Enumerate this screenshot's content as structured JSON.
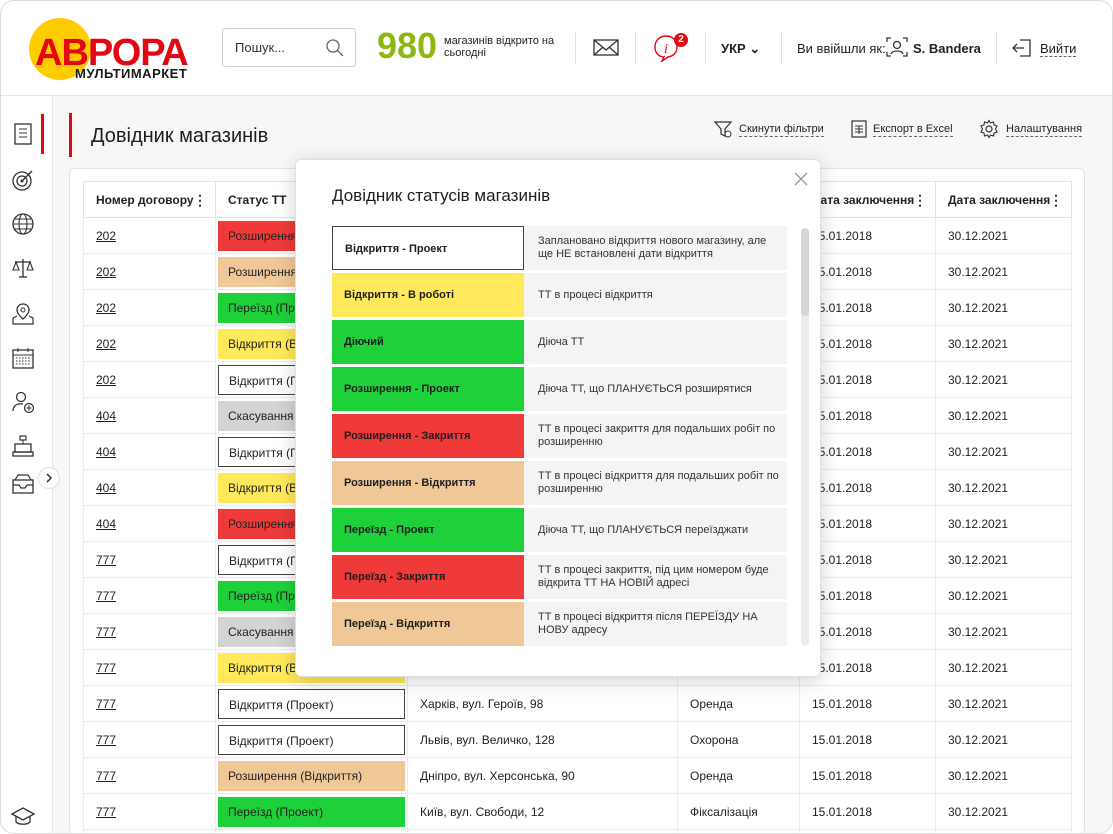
{
  "brand": {
    "logo_text": "АВРОРА",
    "logo_sub": "МУЛЬТИМАРКЕТ"
  },
  "header": {
    "search_placeholder": "Пошук...",
    "stores_open_count": "980",
    "stores_open_label": "магазинів відкрито на сьогодні",
    "notifications_count": "2",
    "language": "УКР",
    "logged_in_as": "Ви ввійшли як:",
    "user_name": "S. Bandera",
    "logout": "Вийти"
  },
  "page": {
    "title": "Довідник магазинів",
    "reset_filters": "Скинути фільтри",
    "export_excel": "Експорт в Excel",
    "settings": "Налаштування"
  },
  "table": {
    "columns": [
      "Номер договору",
      "Статус ТТ",
      "",
      "",
      "Дата заключення",
      "Дата заключення"
    ],
    "rows": [
      {
        "contract": "202",
        "status": "Розширення (Закриття)",
        "status_color": "#f03a3a",
        "address": "",
        "type": "",
        "date1": "15.01.2018",
        "date2": "30.12.2021"
      },
      {
        "contract": "202",
        "status": "Розширення (Відкриття)",
        "status_color": "#f0c898",
        "address": "",
        "type": "",
        "date1": "15.01.2018",
        "date2": "30.12.2021"
      },
      {
        "contract": "202",
        "status": "Переїзд (Проект)",
        "status_color": "#1ed13b",
        "address": "",
        "type": "",
        "date1": "15.01.2018",
        "date2": "30.12.2021"
      },
      {
        "contract": "202",
        "status": "Відкриття (В роботі)",
        "status_color": "#ffe95a",
        "address": "",
        "type": "",
        "date1": "15.01.2018",
        "date2": "30.12.2021"
      },
      {
        "contract": "202",
        "status": "Відкриття (Проект)",
        "status_color": "#ffffff",
        "address": "",
        "type": "",
        "date1": "15.01.2018",
        "date2": "30.12.2021"
      },
      {
        "contract": "404",
        "status": "Скасування (Проект)",
        "status_color": "#d4d4d4",
        "address": "",
        "type": "",
        "date1": "15.01.2018",
        "date2": "30.12.2021"
      },
      {
        "contract": "404",
        "status": "Відкриття (Проект)",
        "status_color": "#ffffff",
        "address": "",
        "type": "",
        "date1": "15.01.2018",
        "date2": "30.12.2021"
      },
      {
        "contract": "404",
        "status": "Відкриття (В роботі)",
        "status_color": "#ffe95a",
        "address": "",
        "type": "",
        "date1": "15.01.2018",
        "date2": "30.12.2021"
      },
      {
        "contract": "404",
        "status": "Розширення (Закриття)",
        "status_color": "#f03a3a",
        "address": "",
        "type": "",
        "date1": "15.01.2018",
        "date2": "30.12.2021"
      },
      {
        "contract": "777",
        "status": "Відкриття (Проект)",
        "status_color": "#ffffff",
        "address": "",
        "type": "",
        "date1": "15.01.2018",
        "date2": "30.12.2021"
      },
      {
        "contract": "777",
        "status": "Переїзд (Проект)",
        "status_color": "#1ed13b",
        "address": "",
        "type": "",
        "date1": "15.01.2018",
        "date2": "30.12.2021"
      },
      {
        "contract": "777",
        "status": "Скасування (Проект)",
        "status_color": "#d4d4d4",
        "address": "",
        "type": "",
        "date1": "15.01.2018",
        "date2": "30.12.2021"
      },
      {
        "contract": "777",
        "status": "Відкриття (В роботі)",
        "status_color": "#ffe95a",
        "address": "",
        "type": "",
        "date1": "15.01.2018",
        "date2": "30.12.2021"
      },
      {
        "contract": "777",
        "status": "Відкриття (Проект)",
        "status_color": "#ffffff",
        "address": "Харків, вул. Героїв, 98",
        "type": "Оренда",
        "date1": "15.01.2018",
        "date2": "30.12.2021"
      },
      {
        "contract": "777",
        "status": "Відкриття (Проект)",
        "status_color": "#ffffff",
        "address": "Львів, вул. Величко, 128",
        "type": "Охорона",
        "date1": "15.01.2018",
        "date2": "30.12.2021"
      },
      {
        "contract": "777",
        "status": "Розширення (Відкриття)",
        "status_color": "#f0c898",
        "address": "Дніпро, вул. Херсонська, 90",
        "type": "Оренда",
        "date1": "15.01.2018",
        "date2": "30.12.2021"
      },
      {
        "contract": "777",
        "status": "Переїзд (Проект)",
        "status_color": "#1ed13b",
        "address": "Київ, вул. Свободи, 12",
        "type": "Фіксалізація",
        "date1": "15.01.2018",
        "date2": "30.12.2021"
      },
      {
        "contract": "",
        "status": "",
        "status_color": "#ffe95a",
        "address": "",
        "type": "",
        "date1": "",
        "date2": ""
      }
    ]
  },
  "modal": {
    "title": "Довідник статусів магазинів",
    "statuses": [
      {
        "label": "Відкриття - Проект",
        "color": "#ffffff",
        "description": "Заплановано відкриття нового магазину, але ще НЕ встановлені дати відкриття"
      },
      {
        "label": "Відкриття - В роботі",
        "color": "#ffe95a",
        "description": "ТТ в процесі відкриття"
      },
      {
        "label": "Діючий",
        "color": "#1ed13b",
        "description": "Діюча ТТ"
      },
      {
        "label": "Розширення - Проект",
        "color": "#1ed13b",
        "description": "Діюча ТТ, що ПЛАНУЄТЬСЯ розширятися"
      },
      {
        "label": "Розширення - Закриття",
        "color": "#f03a3a",
        "description": "ТТ в процесі закриття для подальших робіт по розширенню"
      },
      {
        "label": "Розширення - Відкриття",
        "color": "#f0c898",
        "description": "ТТ в процесі відкриття для подальших робіт по розширенню"
      },
      {
        "label": "Переїзд - Проект",
        "color": "#1ed13b",
        "description": "Діюча ТТ, що ПЛАНУЄТЬСЯ переїзджати"
      },
      {
        "label": "Переїзд - Закриття",
        "color": "#f03a3a",
        "description": "ТТ в процесі закриття, під цим номером буде відкрита ТТ НА НОВІЙ адресі"
      },
      {
        "label": "Переїзд - Відкриття",
        "color": "#f0c898",
        "description": "ТТ в процесі відкриття після ПЕРЕЇЗДУ НА НОВУ адресу"
      }
    ]
  },
  "icons": {
    "sidebar": [
      "document-icon",
      "target-icon",
      "globe-icon",
      "scales-icon",
      "map-pin-icon",
      "calendar-icon",
      "user-add-icon",
      "cash-register-icon",
      "inbox-icon",
      "graduation-cap-icon"
    ],
    "accent": "#e30613",
    "count_color": "#8cb80f"
  }
}
